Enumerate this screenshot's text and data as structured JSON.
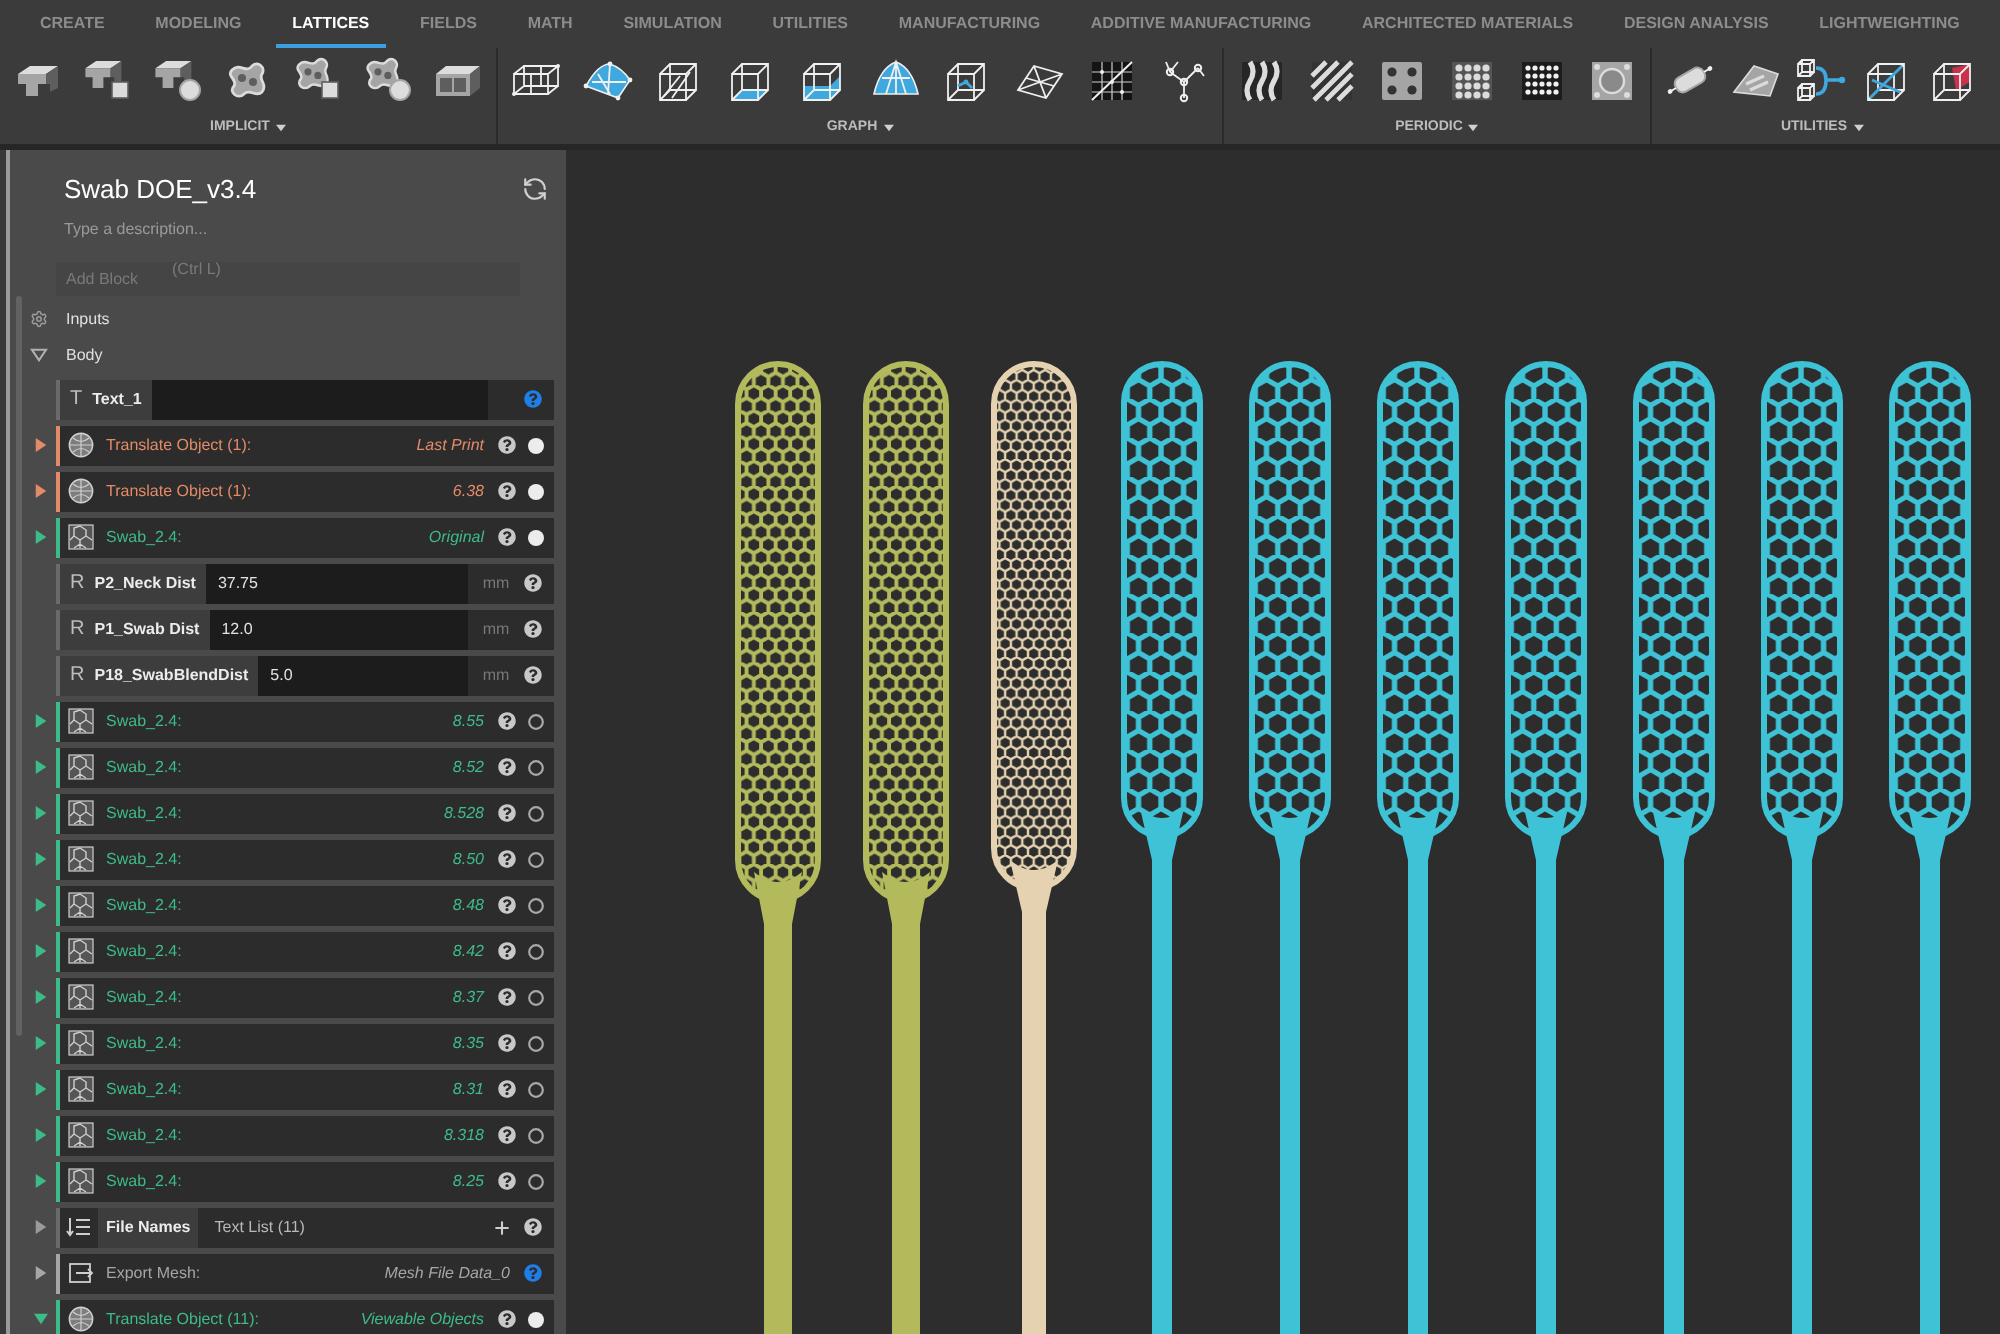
{
  "tabs": [
    {
      "label": "CREATE",
      "selected": false
    },
    {
      "label": "MODELING",
      "selected": false
    },
    {
      "label": "LATTICES",
      "selected": true
    },
    {
      "label": "FIELDS",
      "selected": false
    },
    {
      "label": "MATH",
      "selected": false
    },
    {
      "label": "SIMULATION",
      "selected": false
    },
    {
      "label": "UTILITIES",
      "selected": false
    },
    {
      "label": "MANUFACTURING",
      "selected": false
    },
    {
      "label": "ADDITIVE MANUFACTURING",
      "selected": false
    },
    {
      "label": "ARCHITECTED MATERIALS",
      "selected": false
    },
    {
      "label": "DESIGN ANALYSIS",
      "selected": false
    },
    {
      "label": "LIGHTWEIGHTING",
      "selected": false
    }
  ],
  "toolbar": {
    "groups": [
      {
        "label": "IMPLICIT"
      },
      {
        "label": "GRAPH"
      },
      {
        "label": "PERIODIC"
      },
      {
        "label": "UTILITIES"
      }
    ]
  },
  "panel": {
    "title": "Swab DOE_v3.4",
    "description": {
      "placeholder": "Type a description..."
    },
    "add_block": {
      "placeholder": "Add Block",
      "shortcut": "(Ctrl L)"
    },
    "sections": [
      {
        "kind": "inputs",
        "label": "Inputs"
      },
      {
        "kind": "body",
        "label": "Body",
        "expanded": true
      }
    ],
    "rows": [
      {
        "kind": "text",
        "type_letter": "T",
        "label": "Text_1",
        "help_highlighted": true
      },
      {
        "kind": "translate",
        "label": "Translate Object (1):",
        "value": "Last Print",
        "color": "#e38b68",
        "expanded": false,
        "visible": true,
        "help_highlighted": false
      },
      {
        "kind": "translate",
        "label": "Translate Object (1):",
        "value": "6.38",
        "color": "#e38b68",
        "expanded": false,
        "visible": true,
        "help_highlighted": false
      },
      {
        "kind": "swab",
        "label": "Swab_2.4:",
        "value": "Original",
        "color": "#3dbb88",
        "expanded": false,
        "visible": true,
        "help_highlighted": false
      },
      {
        "kind": "parameter",
        "type_letter": "R",
        "label": "P2_Neck Dist",
        "value": "37.75",
        "unit": "mm",
        "help_highlighted": false
      },
      {
        "kind": "parameter",
        "type_letter": "R",
        "label": "P1_Swab Dist",
        "value": "12.0",
        "unit": "mm",
        "help_highlighted": false
      },
      {
        "kind": "parameter",
        "type_letter": "R",
        "label": "P18_SwabBlendDist",
        "value": "5.0",
        "unit": "mm",
        "help_highlighted": false
      },
      {
        "kind": "swab",
        "label": "Swab_2.4:",
        "value": "8.55",
        "color": "#3dbb88",
        "expanded": false,
        "visible": false,
        "help_highlighted": false
      },
      {
        "kind": "swab",
        "label": "Swab_2.4:",
        "value": "8.52",
        "color": "#3dbb88",
        "expanded": false,
        "visible": false,
        "help_highlighted": false
      },
      {
        "kind": "swab",
        "label": "Swab_2.4:",
        "value": "8.528",
        "color": "#3dbb88",
        "expanded": false,
        "visible": false,
        "help_highlighted": false
      },
      {
        "kind": "swab",
        "label": "Swab_2.4:",
        "value": "8.50",
        "color": "#3dbb88",
        "expanded": false,
        "visible": false,
        "help_highlighted": false
      },
      {
        "kind": "swab",
        "label": "Swab_2.4:",
        "value": "8.48",
        "color": "#3dbb88",
        "expanded": false,
        "visible": false,
        "help_highlighted": false
      },
      {
        "kind": "swab",
        "label": "Swab_2.4:",
        "value": "8.42",
        "color": "#3dbb88",
        "expanded": false,
        "visible": false,
        "help_highlighted": false
      },
      {
        "kind": "swab",
        "label": "Swab_2.4:",
        "value": "8.37",
        "color": "#3dbb88",
        "expanded": false,
        "visible": false,
        "help_highlighted": false
      },
      {
        "kind": "swab",
        "label": "Swab_2.4:",
        "value": "8.35",
        "color": "#3dbb88",
        "expanded": false,
        "visible": false,
        "help_highlighted": false
      },
      {
        "kind": "swab",
        "label": "Swab_2.4:",
        "value": "8.31",
        "color": "#3dbb88",
        "expanded": false,
        "visible": false,
        "help_highlighted": false
      },
      {
        "kind": "swab",
        "label": "Swab_2.4:",
        "value": "8.318",
        "color": "#3dbb88",
        "expanded": false,
        "visible": false,
        "help_highlighted": false
      },
      {
        "kind": "swab",
        "label": "Swab_2.4:",
        "value": "8.25",
        "color": "#3dbb88",
        "expanded": false,
        "visible": false,
        "help_highlighted": false
      },
      {
        "kind": "list",
        "label": "File Names",
        "value": "Text List (11)",
        "color": "#9a9a9a",
        "expanded": false,
        "help_highlighted": false
      },
      {
        "kind": "export",
        "label": "Export Mesh:",
        "value": "Mesh File Data_0",
        "color": "#a6a6a6",
        "expanded": false,
        "help_highlighted": true
      },
      {
        "kind": "translate",
        "label": "Translate Object (11):",
        "value": "Viewable Objects",
        "color": "#3dbb88",
        "expanded": true,
        "visible": true,
        "help_highlighted": false
      }
    ]
  },
  "viewport": {
    "models": [
      {
        "kind": "dense",
        "color": "#b3ba5c"
      },
      {
        "kind": "dense",
        "color": "#b3ba5c"
      },
      {
        "kind": "fine",
        "color": "#e4d2b0"
      },
      {
        "kind": "open",
        "color": "#3ec3d6"
      },
      {
        "kind": "open",
        "color": "#3ec3d6"
      },
      {
        "kind": "open",
        "color": "#3ec3d6"
      },
      {
        "kind": "open",
        "color": "#3ec3d6"
      },
      {
        "kind": "open",
        "color": "#3ec3d6"
      },
      {
        "kind": "open",
        "color": "#3ec3d6"
      },
      {
        "kind": "open",
        "color": "#3ec3d6"
      }
    ]
  }
}
